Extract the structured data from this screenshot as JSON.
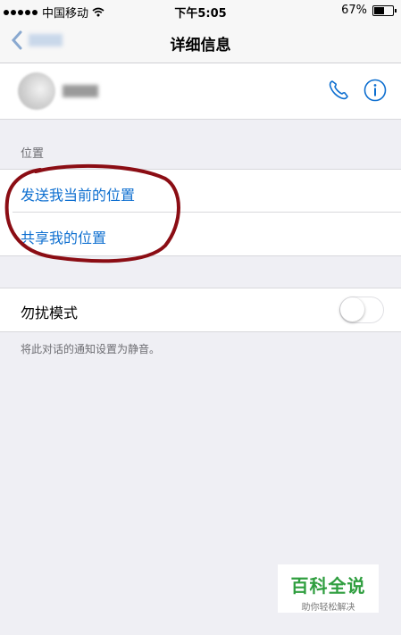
{
  "status_bar": {
    "carrier": "中国移动",
    "time": "下午5:05",
    "battery": "67%",
    "battery_level": 0.67,
    "wifi_icon": "wifi-icon"
  },
  "nav": {
    "title": "详细信息",
    "back_icon": "chevron-left-icon"
  },
  "contact": {
    "phone_icon": "phone-icon",
    "info_icon": "info-icon"
  },
  "location": {
    "header": "位置",
    "send_current": "发送我当前的位置",
    "share": "共享我的位置"
  },
  "dnd": {
    "label": "勿扰模式",
    "enabled": false,
    "note": "将此对话的通知设置为静音。"
  },
  "watermark": {
    "title": "百科全说",
    "subtitle": "助你轻松解决"
  },
  "colors": {
    "accent": "#0e6fd0",
    "annotation": "#8b0d14",
    "watermark_green": "#2f9e3f",
    "background": "#efeff4"
  }
}
